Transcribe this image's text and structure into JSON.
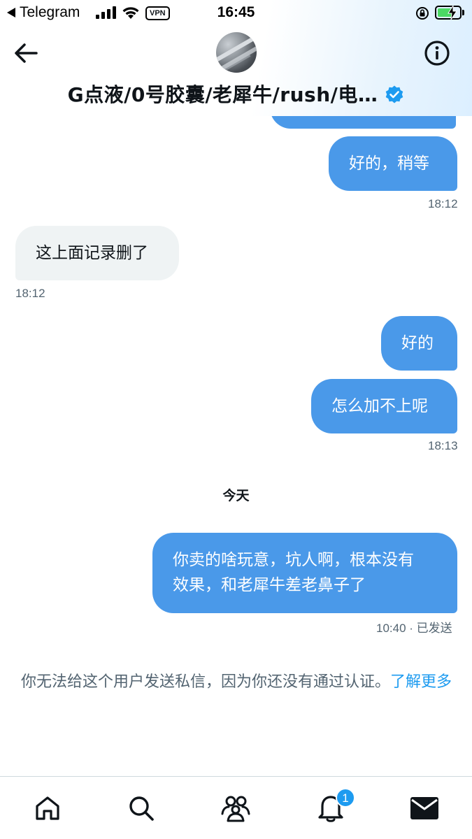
{
  "status_bar": {
    "back_app": "Telegram",
    "time": "16:45",
    "vpn": "VPN"
  },
  "header": {
    "title": "G点液/0号胶囊/老犀牛/rush/电…"
  },
  "messages": [
    {
      "text": "好的，稍等",
      "time": "18:12"
    },
    {
      "text": "这上面记录删了",
      "time": "18:12"
    },
    {
      "text": "好的"
    },
    {
      "text": "怎么加不上呢",
      "time": "18:13"
    },
    {
      "text_line1": "你卖的啥玩意，坑人啊，根本没有",
      "text_line2": "效果，和老犀牛差老鼻子了",
      "time": "10:40 · 已发送"
    }
  ],
  "date_separator": "今天",
  "notice": {
    "text": "你无法给这个用户发送私信，因为你还没有通过认证。",
    "link": "了解更多"
  },
  "bottom_nav": {
    "notification_badge": "1"
  },
  "colors": {
    "outgoing_bubble": "#4a99e9",
    "incoming_bubble": "#eff3f4",
    "accent": "#1d9bf0"
  }
}
